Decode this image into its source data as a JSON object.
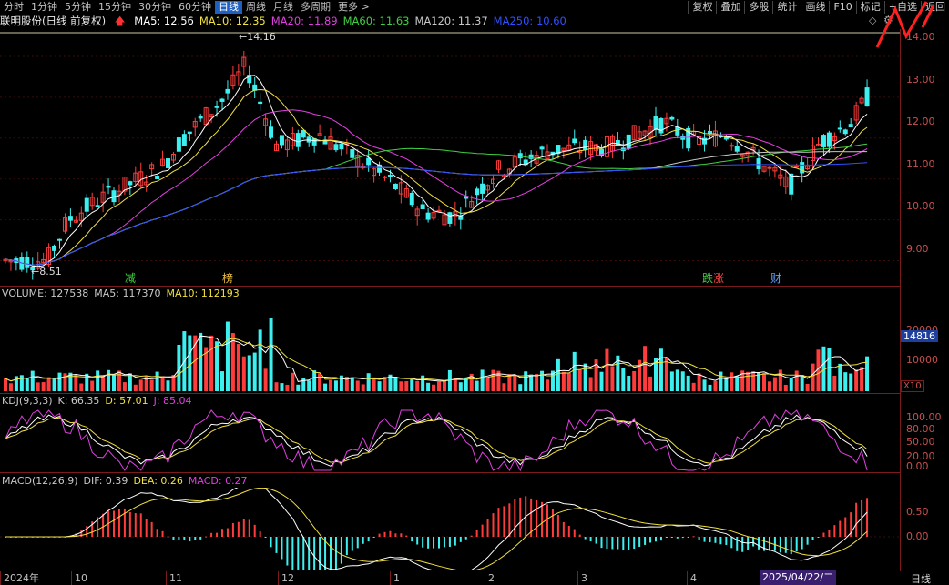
{
  "toolbar": {
    "periods": [
      "分时",
      "1分钟",
      "5分钟",
      "15分钟",
      "30分钟",
      "60分钟",
      "日线",
      "周线",
      "月线",
      "多周期",
      "更多"
    ],
    "active_period": "日线",
    "right_buttons": [
      "复权",
      "叠加",
      "多股",
      "统计",
      "画线",
      "F10",
      "标记",
      "+自选",
      "返回"
    ]
  },
  "stock": {
    "title": "联明股份(日线 前复权)",
    "ma_labels": [
      {
        "text": "MA5: 12.56",
        "color": "#ffffff"
      },
      {
        "text": "MA10: 12.35",
        "color": "#f0e040"
      },
      {
        "text": "MA20: 11.89",
        "color": "#e040e0"
      },
      {
        "text": "MA60: 11.63",
        "color": "#40d040"
      },
      {
        "text": "MA120: 11.37",
        "color": "#c8c8c8"
      },
      {
        "text": "MA250: 10.60",
        "color": "#3050ff"
      }
    ],
    "high_label": "14.16",
    "low_label": "8.51",
    "price_axis": [
      "14.00",
      "13.00",
      "12.00",
      "11.00",
      "10.00",
      "9.00"
    ],
    "event_markers": [
      {
        "text": "减",
        "color": "#40d040"
      },
      {
        "text": "榜",
        "color": "#f0c040"
      },
      {
        "text": "跌",
        "color": "#40d040"
      },
      {
        "text": "涨",
        "color": "#ff4040"
      },
      {
        "text": "财",
        "color": "#60a0ff"
      }
    ]
  },
  "volume": {
    "labels": [
      {
        "text": "VOLUME: 127538",
        "color": "#c8c8c8"
      },
      {
        "text": "MA5: 117370",
        "color": "#c8c8c8"
      },
      {
        "text": "MA10: 112193",
        "color": "#f0e040"
      }
    ],
    "axis": [
      "20000",
      "10000"
    ],
    "current_tag": "14816",
    "unit": "X10"
  },
  "kdj": {
    "labels": [
      {
        "text": "KDJ(9,3,3)",
        "color": "#c8c8c8"
      },
      {
        "text": "K: 66.35",
        "color": "#c8c8c8"
      },
      {
        "text": "D: 57.01",
        "color": "#f0e040"
      },
      {
        "text": "J: 85.04",
        "color": "#e040e0"
      }
    ],
    "axis": [
      "100.00",
      "80.00",
      "50.00",
      "20.00",
      "0.00"
    ]
  },
  "macd": {
    "labels": [
      {
        "text": "MACD(12,26,9)",
        "color": "#c8c8c8"
      },
      {
        "text": "DIF: 0.39",
        "color": "#c8c8c8"
      },
      {
        "text": "DEA: 0.26",
        "color": "#f0e040"
      },
      {
        "text": "MACD: 0.27",
        "color": "#e040e0"
      }
    ],
    "axis": [
      "0.50",
      "0.00"
    ]
  },
  "time_axis": [
    "2024年",
    "10",
    "11",
    "12",
    "1",
    "2",
    "3",
    "4"
  ],
  "cursor_date": "2025/04/22/二",
  "period_label": "日线",
  "colors": {
    "up": "#ff3c3c",
    "down": "#3cf0f0",
    "grid": "#7a1c1c",
    "accent": "#1f5fbf"
  }
}
